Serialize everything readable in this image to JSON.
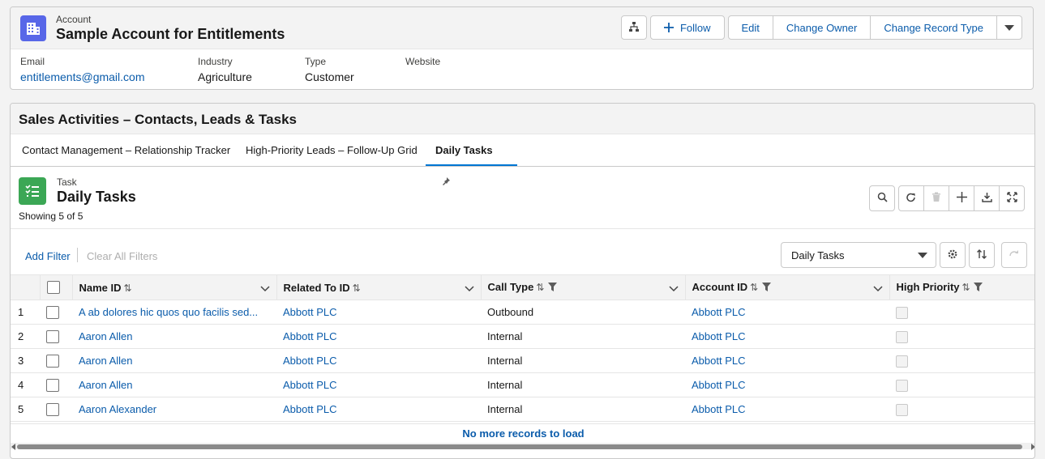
{
  "account": {
    "object_label": "Account",
    "name": "Sample Account for Entitlements",
    "actions": {
      "follow": "Follow",
      "edit": "Edit",
      "change_owner": "Change Owner",
      "change_record_type": "Change Record Type"
    },
    "fields": {
      "email_label": "Email",
      "email_value": "entitlements@gmail.com",
      "industry_label": "Industry",
      "industry_value": "Agriculture",
      "type_label": "Type",
      "type_value": "Customer",
      "website_label": "Website",
      "website_value": ""
    }
  },
  "activities": {
    "title": "Sales Activities – Contacts, Leads & Tasks",
    "tabs": [
      {
        "label": "Contact Management – Relationship Tracker"
      },
      {
        "label": "High-Priority Leads – Follow-Up Grid"
      },
      {
        "label": "Daily Tasks",
        "active": true
      }
    ]
  },
  "task_list": {
    "object_label": "Task",
    "title": "Daily Tasks",
    "count_text": "Showing 5 of 5",
    "add_filter": "Add Filter",
    "clear_filters": "Clear All Filters",
    "view_selected": "Daily Tasks",
    "columns": [
      "Name ID",
      "Related To ID",
      "Call Type",
      "Account ID",
      "High Priority"
    ],
    "rows": [
      {
        "num": "1",
        "name": "A ab dolores hic quos quo facilis sed...",
        "related": "Abbott PLC",
        "call_type": "Outbound",
        "account": "Abbott PLC",
        "high_priority": false
      },
      {
        "num": "2",
        "name": "Aaron Allen",
        "related": "Abbott PLC",
        "call_type": "Internal",
        "account": "Abbott PLC",
        "high_priority": false
      },
      {
        "num": "3",
        "name": "Aaron Allen",
        "related": "Abbott PLC",
        "call_type": "Internal",
        "account": "Abbott PLC",
        "high_priority": false
      },
      {
        "num": "4",
        "name": "Aaron Allen",
        "related": "Abbott PLC",
        "call_type": "Internal",
        "account": "Abbott PLC",
        "high_priority": false
      },
      {
        "num": "5",
        "name": "Aaron Alexander",
        "related": "Abbott PLC",
        "call_type": "Internal",
        "account": "Abbott PLC",
        "high_priority": false
      }
    ],
    "footer_text": "No more records to load"
  },
  "colors": {
    "link": "#0b5cab",
    "account_icon": "#5867e8",
    "task_icon": "#3ba755",
    "active_tab": "#0176d3"
  },
  "icons": [
    "building-icon",
    "hierarchy-icon",
    "plus-icon",
    "chevron-down-icon",
    "pin-icon",
    "task-list-icon",
    "search-icon",
    "refresh-icon",
    "trash-icon",
    "download-icon",
    "expand-icon",
    "gear-icon",
    "sort-icon",
    "undo-icon",
    "filter-icon"
  ]
}
